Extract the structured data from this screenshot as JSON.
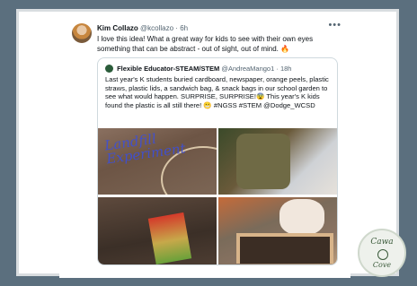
{
  "tweet": {
    "author_name": "Kim Collazo",
    "author_handle": "@kcollazo",
    "time": "6h",
    "text": "I love this idea! What a great way for kids to see with their own eyes something that can be abstract - out of sight, out of mind. 🔥",
    "more_icon": "more-horizontal-icon"
  },
  "quote": {
    "author_name": "Flexible Educator-STEAM/STEM",
    "author_handle": "@AndreaMango1",
    "time": "18h",
    "text": "Last year's K students buried cardboard,  newspaper,  orange peels, plastic straws, plastic lids, a sandwich bag, & snack bags in our school garden to see what would happen.  SURPRISE, SURPRISE!😨 This year's K kids found the plastic is all still there! 😬 #NGSS #STEM @Dodge_WCSD",
    "photo_paint_text": "Landfill Experiment"
  },
  "watermark": {
    "line1": "Cawa",
    "line2": "Cove"
  }
}
